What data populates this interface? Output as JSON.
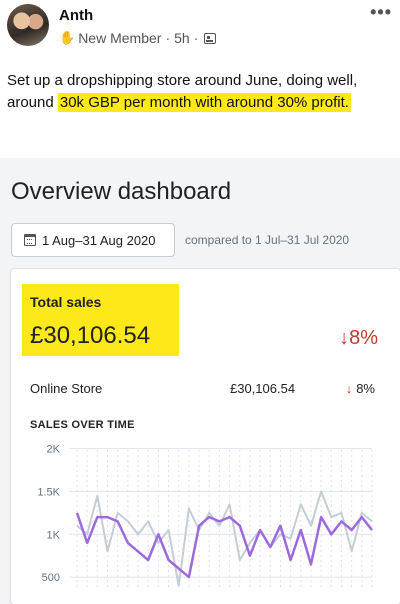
{
  "post": {
    "author": "Anth",
    "badge": "New Member",
    "time": "5h",
    "separator": "·",
    "more": "•••",
    "text_plain": "Set up a dropshipping store around June, doing well, around ",
    "text_highlight": "30k GBP per month with around 30% profit."
  },
  "dashboard": {
    "title": "Overview dashboard",
    "date_range": "1 Aug–31 Aug 2020",
    "compare": "compared to 1 Jul–31 Jul 2020",
    "highlight_color": "#fde81a",
    "total_sales": {
      "label": "Total sales",
      "value": "£30,106.54",
      "change": "↓8%"
    },
    "channel": {
      "label": "Online Store",
      "value": "£30,106.54",
      "change_arrow": "↓",
      "change": "8%"
    },
    "chart_title": "SALES OVER TIME"
  },
  "chart_data": {
    "type": "line",
    "title": "SALES OVER TIME",
    "yticks": [
      "2K",
      "1.5K",
      "1K",
      "500"
    ],
    "ylim": [
      350,
      2100
    ],
    "grid": true,
    "series": [
      {
        "color": "#9c6ade",
        "values": [
          1250,
          900,
          1200,
          1200,
          1150,
          900,
          800,
          700,
          1000,
          700,
          600,
          500,
          1100,
          1200,
          1150,
          1200,
          1100,
          750,
          1050,
          850,
          1100,
          700,
          1050,
          650,
          1200,
          1000,
          1150,
          1050,
          1200,
          1050
        ]
      },
      {
        "color": "#c4cdd5",
        "values": [
          1100,
          1000,
          1450,
          800,
          1250,
          1150,
          1000,
          1150,
          900,
          1050,
          400,
          1300,
          1050,
          1250,
          1100,
          1350,
          700,
          900,
          1050,
          850,
          1000,
          950,
          1350,
          1100,
          1500,
          1200,
          1250,
          800,
          1250,
          1150
        ]
      }
    ]
  }
}
